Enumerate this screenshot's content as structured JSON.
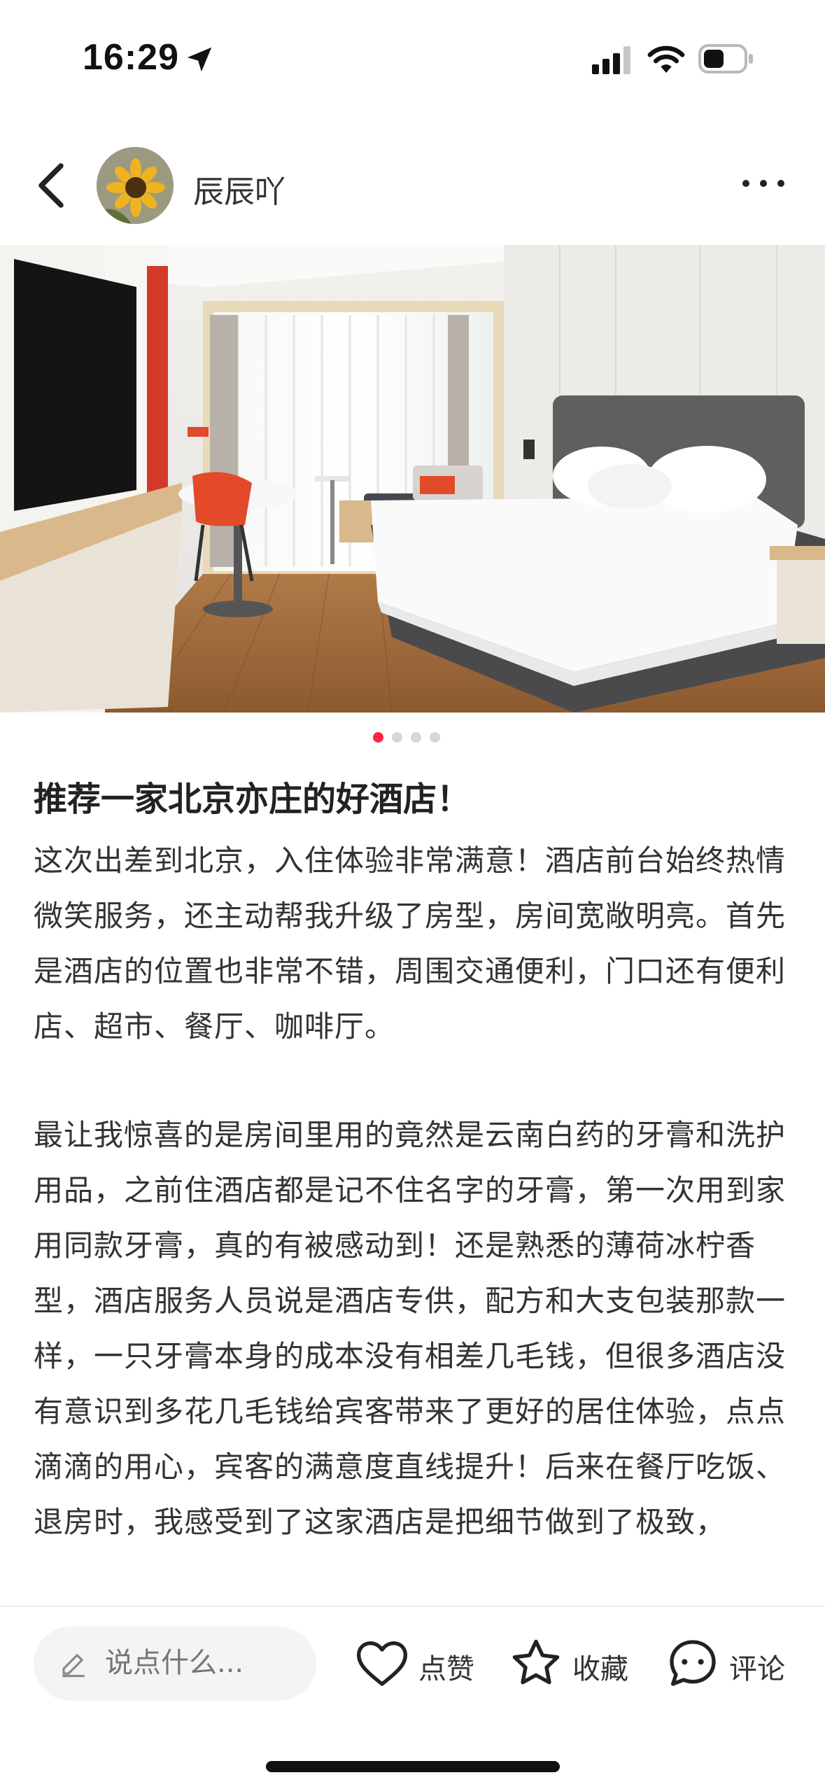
{
  "status_bar": {
    "time": "16:29"
  },
  "header": {
    "author_name": "辰辰吖"
  },
  "carousel": {
    "total": 4,
    "active_index": 0,
    "active_color": "#ff2442"
  },
  "post": {
    "title": "推荐一家北京亦庄的好酒店！",
    "paragraph1": "这次出差到北京，入住体验非常满意！酒店前台始终热情微笑服务，还主动帮我升级了房型，房间宽敞明亮。首先是酒店的位置也非常不错，周围交通便利，门口还有便利店、超市、餐厅、咖啡厅。",
    "paragraph2": "最让我惊喜的是房间里用的竟然是云南白药的牙膏和洗护用品，之前住酒店都是记不住名字的牙膏，第一次用到家用同款牙膏，真的有被感动到！还是熟悉的薄荷冰柠香型，酒店服务人员说是酒店专供，配方和大支包装那款一样，一只牙膏本身的成本没有相差几毛钱，但很多酒店没有意识到多花几毛钱给宾客带来了更好的居住体验，点点滴滴的用心，宾客的满意度直线提升！后来在餐厅吃饭、退房时，我感受到了这家酒店是把细节做到了极致，"
  },
  "bottom_bar": {
    "input_placeholder": "说点什么...",
    "like_label": "点赞",
    "collect_label": "收藏",
    "comment_label": "评论"
  }
}
